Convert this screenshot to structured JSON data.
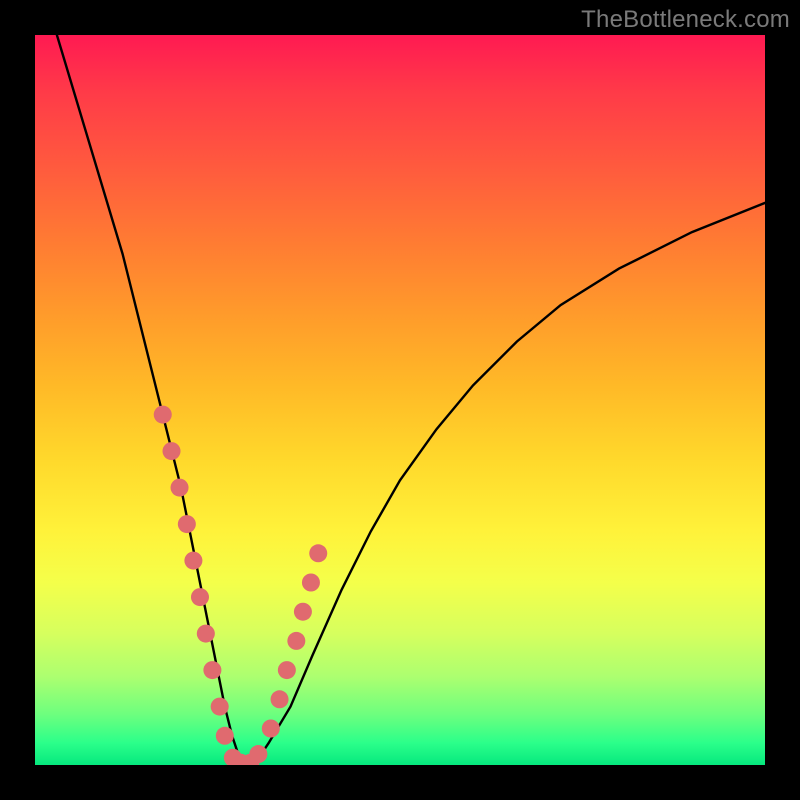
{
  "watermark": {
    "text": "TheBottleneck.com"
  },
  "chart_data": {
    "type": "line",
    "title": "",
    "xlabel": "",
    "ylabel": "",
    "xlim": [
      0,
      100
    ],
    "ylim": [
      0,
      100
    ],
    "series": [
      {
        "name": "bottleneck-curve",
        "x": [
          3,
          6,
          9,
          12,
          14,
          16,
          18,
          20,
          21,
          22,
          23,
          24,
          25,
          26,
          27,
          28,
          29,
          30,
          32,
          35,
          38,
          42,
          46,
          50,
          55,
          60,
          66,
          72,
          80,
          90,
          100
        ],
        "y": [
          100,
          90,
          80,
          70,
          62,
          54,
          46,
          38,
          33,
          28,
          23,
          18,
          13,
          8,
          4,
          1,
          0,
          0,
          3,
          8,
          15,
          24,
          32,
          39,
          46,
          52,
          58,
          63,
          68,
          73,
          77
        ]
      }
    ],
    "markers": {
      "name": "highlight-dots",
      "color": "#e06a6f",
      "radius_px": 9,
      "x": [
        17.5,
        18.7,
        19.8,
        20.8,
        21.7,
        22.6,
        23.4,
        24.3,
        25.3,
        26.0,
        27.1,
        28.2,
        29.5,
        30.6,
        32.3,
        33.5,
        34.5,
        35.8,
        36.7,
        37.8,
        38.8
      ],
      "y": [
        48,
        43,
        38,
        33,
        28,
        23,
        18,
        13,
        8,
        4,
        1,
        0.3,
        0.3,
        1.5,
        5,
        9,
        13,
        17,
        21,
        25,
        29
      ]
    }
  }
}
